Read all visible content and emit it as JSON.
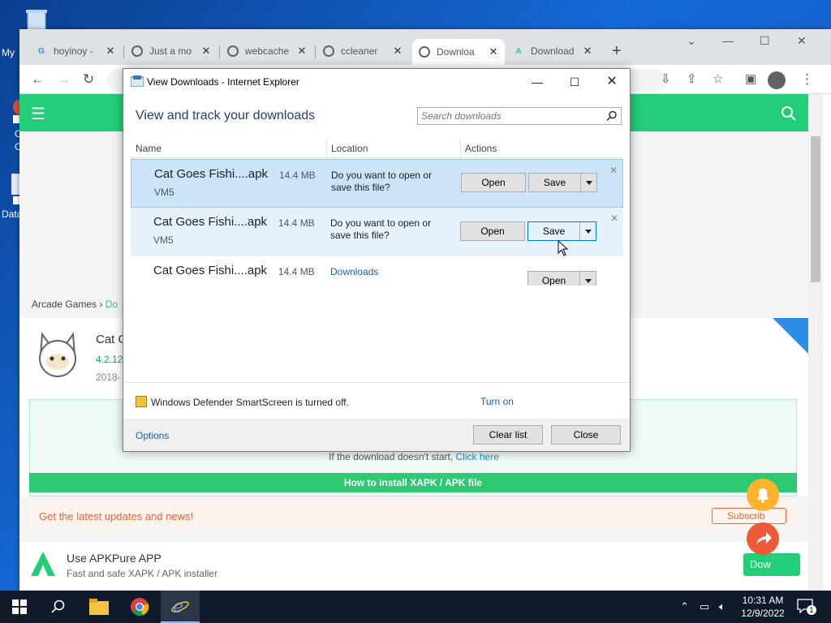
{
  "desktop": {
    "icons": [
      {
        "label": "My"
      },
      {
        "label": "C"
      },
      {
        "label": "C"
      },
      {
        "label": "Data"
      }
    ]
  },
  "browser": {
    "tabs": [
      {
        "title": "hoyinoy -",
        "icon": "google-icon",
        "color": "#4285f4"
      },
      {
        "title": "Just a mo",
        "icon": "globe-icon",
        "color": "#5f6368"
      },
      {
        "title": "webcache",
        "icon": "globe-icon",
        "color": "#5f6368"
      },
      {
        "title": "ccleaner",
        "icon": "globe-icon",
        "color": "#5f6368"
      },
      {
        "title": "Downloa",
        "icon": "globe-icon",
        "color": "#5f6368"
      },
      {
        "title": "Download",
        "icon": "apkpure-icon",
        "color": "#24cd77"
      }
    ],
    "new_tab": "+",
    "page": {
      "breadcrumb_parent": "Arcade Games",
      "breadcrumb_current": "Do",
      "app_name": "Cat G",
      "app_version": "4.2.12",
      "app_date": "2018-",
      "download_hint": "If the download doesn't start,",
      "click_here": "Click here",
      "how_to": "How to install XAPK / APK file",
      "news": "Get the latest updates and news!",
      "subscribe": "Subscrib",
      "use_app_title": "Use APKPure APP",
      "use_app_sub": "Fast and safe XAPK / APK installer",
      "use_app_button": "Dow"
    }
  },
  "dialog": {
    "title": "View Downloads - Internet Explorer",
    "heading": "View and track your downloads",
    "search_placeholder": "Search downloads",
    "columns": {
      "name": "Name",
      "location": "Location",
      "actions": "Actions"
    },
    "rows": [
      {
        "name": "Cat Goes Fishi....apk",
        "size": "14.4 MB",
        "site": "VM5",
        "location": "Do you want to open or save this file?",
        "open": "Open",
        "save": "Save"
      },
      {
        "name": "Cat Goes Fishi....apk",
        "size": "14.4 MB",
        "site": "VM5",
        "location": "Do you want to open or save this file?",
        "open": "Open",
        "save": "Save"
      },
      {
        "name": "Cat Goes Fishi....apk",
        "size": "14.4 MB",
        "site": "",
        "location": "Downloads",
        "open": "Open"
      }
    ],
    "smartscreen": "Windows Defender SmartScreen is turned off.",
    "turn_on": "Turn on",
    "options": "Options",
    "clear_list": "Clear list",
    "close": "Close"
  },
  "taskbar": {
    "time": "10:31 AM",
    "date": "12/9/2022",
    "notification_count": "1"
  }
}
